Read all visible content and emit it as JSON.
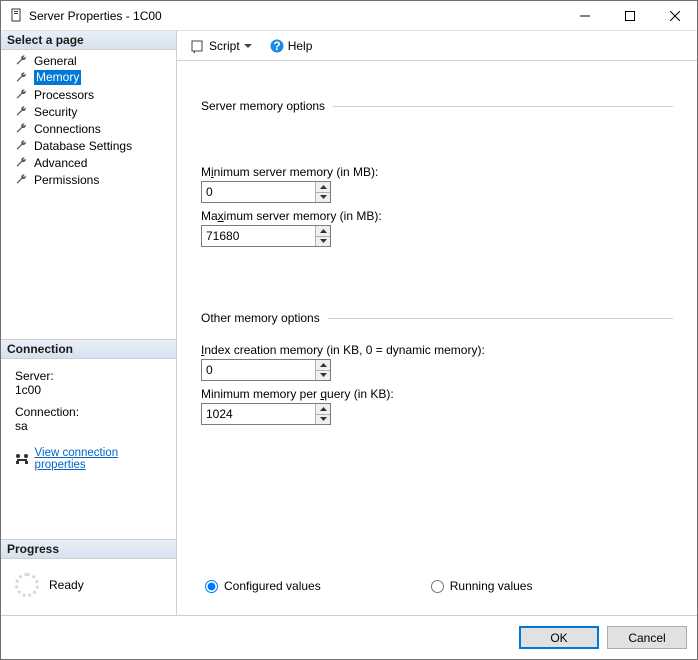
{
  "window": {
    "title": "Server Properties - 1C00"
  },
  "toolbar": {
    "script": "Script",
    "help": "Help"
  },
  "sidebar": {
    "select_page": "Select a page",
    "pages": [
      "General",
      "Memory",
      "Processors",
      "Security",
      "Connections",
      "Database Settings",
      "Advanced",
      "Permissions"
    ],
    "selected_index": 1,
    "connection": {
      "header": "Connection",
      "server_lbl": "Server:",
      "server_val": "1c00",
      "conn_lbl": "Connection:",
      "conn_val": "sa",
      "link": "View connection properties"
    },
    "progress": {
      "header": "Progress",
      "status": "Ready"
    }
  },
  "content": {
    "group1": "Server memory options",
    "min_mem_label_pre": "M",
    "min_mem_label_u": "i",
    "min_mem_label_post": "nimum server memory (in MB):",
    "min_mem_val": "0",
    "max_mem_label_pre": "Ma",
    "max_mem_label_u": "x",
    "max_mem_label_post": "imum server memory (in MB):",
    "max_mem_val": "71680",
    "group2": "Other memory options",
    "idx_mem_label_pre": "",
    "idx_mem_label_u": "I",
    "idx_mem_label_post": "ndex creation memory (in KB, 0 = dynamic memory):",
    "idx_mem_val": "0",
    "minq_label_pre": "Minimum memory per ",
    "minq_label_u": "q",
    "minq_label_post": "uery (in KB):",
    "minq_val": "1024",
    "radio_conf_pre": "",
    "radio_conf_u": "C",
    "radio_conf_post": "onfigured values",
    "radio_run_pre": "",
    "radio_run_u": "R",
    "radio_run_post": "unning values"
  },
  "footer": {
    "ok": "OK",
    "cancel": "Cancel"
  }
}
